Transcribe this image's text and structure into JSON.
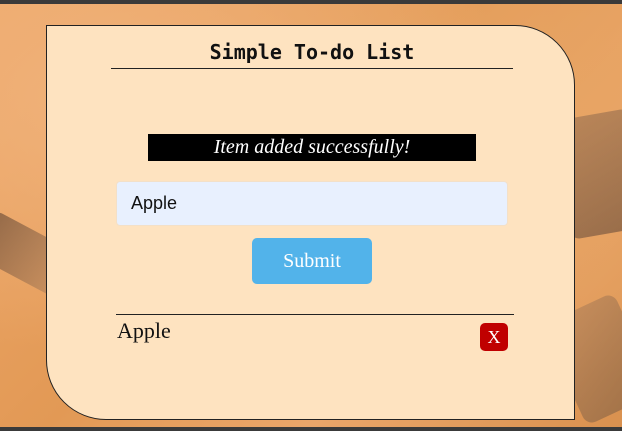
{
  "app": {
    "title": "Simple To-do List"
  },
  "notification": {
    "message": "Item added successfully!"
  },
  "form": {
    "input_value": "Apple",
    "submit_label": "Submit"
  },
  "todo_list": {
    "items": [
      {
        "label": "Apple",
        "delete_label": "X"
      }
    ]
  },
  "colors": {
    "card_background": "#fee3c0",
    "banner_background": "#000000",
    "input_background": "#e8f0fe",
    "submit_button": "#52b3ea",
    "delete_button": "#c00000"
  }
}
